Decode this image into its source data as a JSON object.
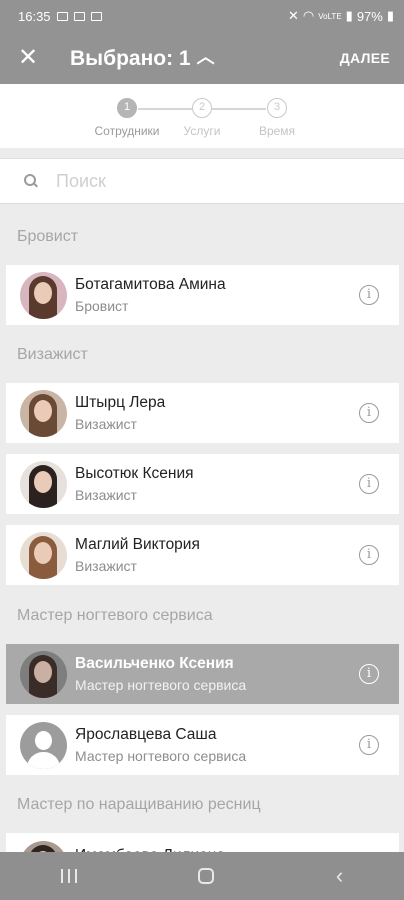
{
  "status": {
    "time": "16:35",
    "battery": "97%",
    "signal": "VoLTE"
  },
  "appbar": {
    "close_icon": "close-icon",
    "title": "Выбрано: 1",
    "next_label": "ДАЛЕЕ"
  },
  "stepper": [
    {
      "num": "1",
      "label": "Сотрудники"
    },
    {
      "num": "2",
      "label": "Услуги"
    },
    {
      "num": "3",
      "label": "Время"
    }
  ],
  "search": {
    "placeholder": "Поиск"
  },
  "sections": [
    {
      "title": "Бровист",
      "items": [
        {
          "name": "Ботагамитова Амина",
          "role": "Бровист"
        }
      ]
    },
    {
      "title": "Визажист",
      "items": [
        {
          "name": "Штырц Лера",
          "role": "Визажист"
        },
        {
          "name": "Высотюк Ксения",
          "role": "Визажист"
        },
        {
          "name": "Маглий Виктория",
          "role": "Визажист"
        }
      ]
    },
    {
      "title": "Мастер ногтевого сервиса",
      "items": [
        {
          "name": "Васильченко Ксения",
          "role": "Мастер ногтевого сервиса",
          "selected": true
        },
        {
          "name": "Ярославцева Саша",
          "role": "Мастер ногтевого сервиса"
        }
      ]
    },
    {
      "title": "Мастер по наращиванию ресниц",
      "items": [
        {
          "name": "Имамбаева Лилиана",
          "role": ""
        }
      ]
    }
  ],
  "colors": {
    "dim_overlay": "#939393",
    "selected_row": "#a9a9a9",
    "background": "#ececec"
  }
}
